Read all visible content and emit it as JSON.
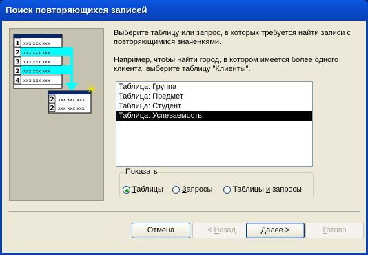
{
  "window": {
    "title": "Поиск повторяющихся записей"
  },
  "description": {
    "line1": "Выберите таблицу или запрос, в которых требуется найти записи с повторяющимися значениями.",
    "line2": "Например, чтобы найти город, в котором имеется более одного клиента, выберите таблицу \"Клиенты\"."
  },
  "illustration": {
    "rows": [
      "1",
      "2",
      "3",
      "2",
      "4"
    ],
    "dups": [
      "2",
      "2"
    ],
    "cell_text": "xxx xxx xxx"
  },
  "list": {
    "items": [
      "Таблица: Группа",
      "Таблица: Предмет",
      "Таблица: Студент",
      "Таблица: Успеваемость"
    ],
    "selected_index": 3
  },
  "show_group": {
    "legend": "Показать",
    "options": [
      {
        "pre": "",
        "accel": "Т",
        "post": "аблицы",
        "selected": true
      },
      {
        "pre": "",
        "accel": "З",
        "post": "апросы",
        "selected": false
      },
      {
        "pre": "Таблицы ",
        "accel": "и",
        "post": " запросы",
        "selected": false
      }
    ]
  },
  "buttons": {
    "cancel": "Отмена",
    "back": {
      "pre": "< ",
      "accel": "Н",
      "post": "азад"
    },
    "next": {
      "pre": "",
      "accel": "Д",
      "post": "алее >"
    },
    "finish": {
      "pre": "",
      "accel": "Г",
      "post": "отово"
    }
  },
  "colors": {
    "accent": "#00ffff",
    "selection": "#000000",
    "titlebar": "#0a4bd0"
  }
}
